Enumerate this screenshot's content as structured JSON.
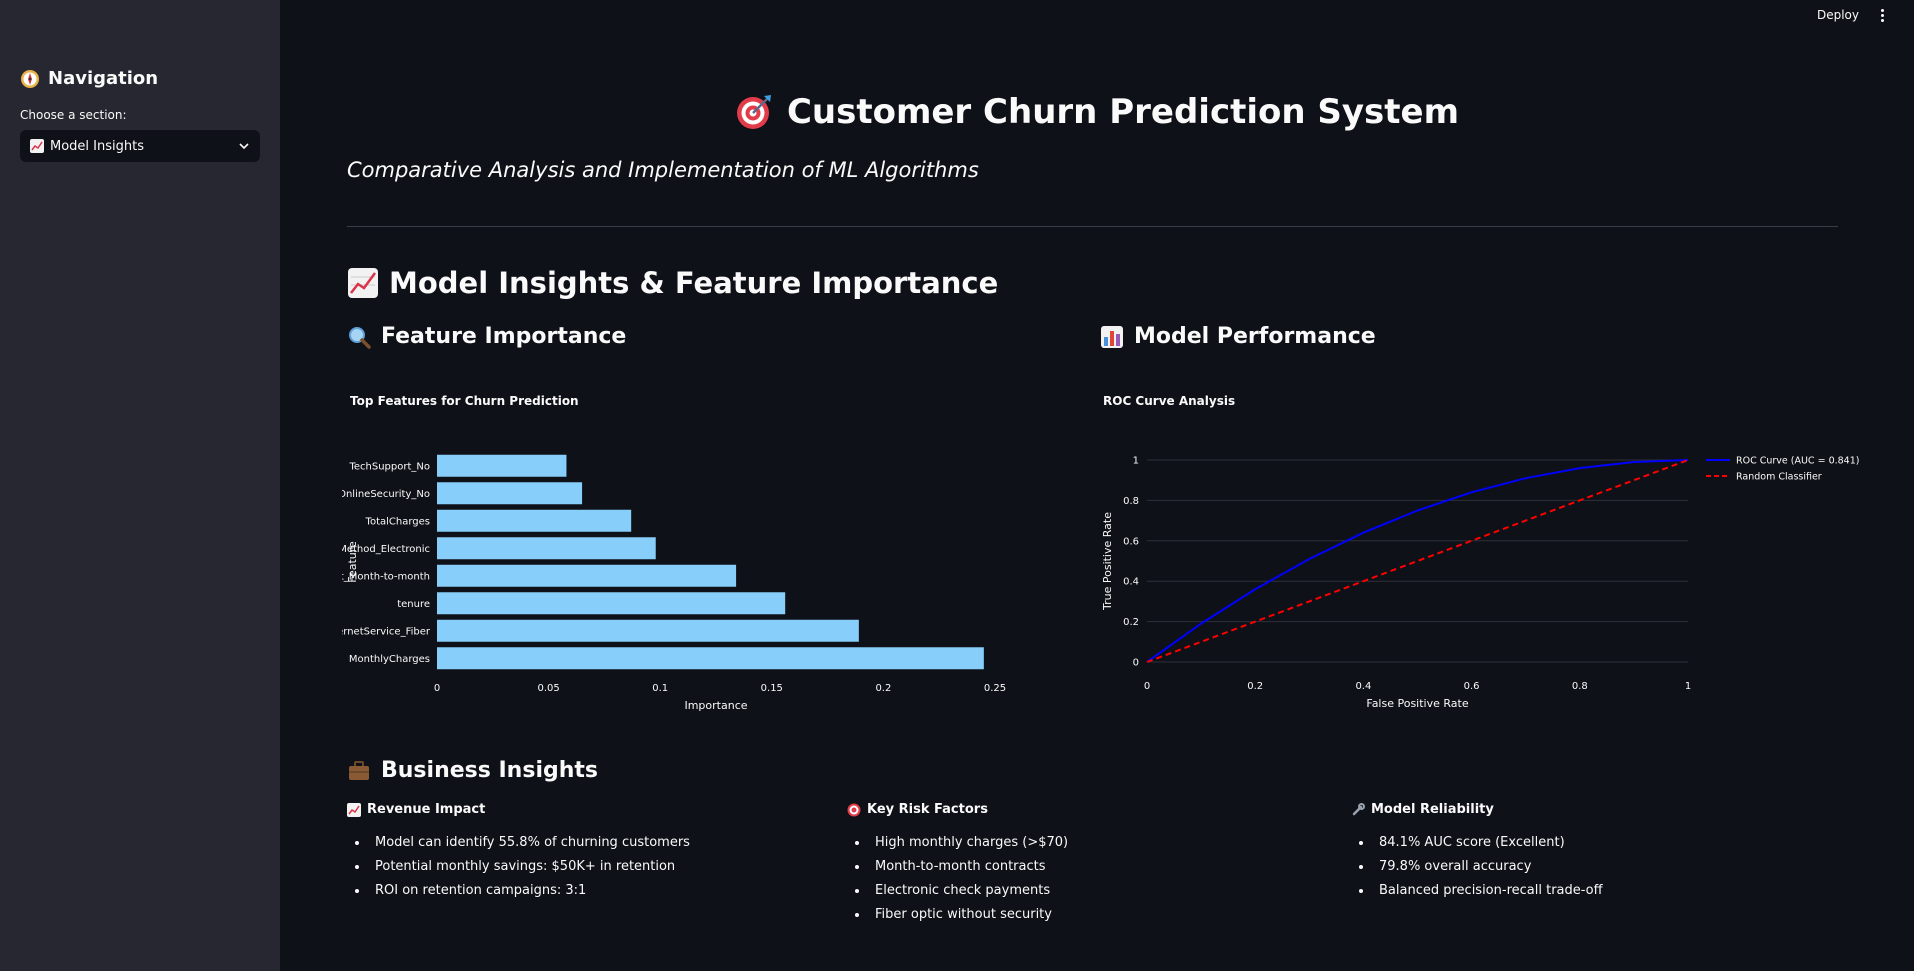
{
  "topbar": {
    "deploy_label": "Deploy",
    "menu_icon": "more-vert-icon"
  },
  "sidebar": {
    "title": "Navigation",
    "title_icon": "compass-icon",
    "select_label": "Choose a section:",
    "selected": "Model Insights",
    "selected_icon": "chart-up-icon"
  },
  "header": {
    "title": "Customer Churn Prediction System",
    "title_icon": "target-icon",
    "subtitle": "Comparative Analysis and Implementation of ML Algorithms"
  },
  "section": {
    "title": "Model Insights & Feature Importance",
    "title_icon": "chart-up-icon"
  },
  "feature_panel": {
    "title": "Feature Importance",
    "title_icon": "magnifier-icon"
  },
  "performance_panel": {
    "title": "Model Performance",
    "title_icon": "bar-chart-icon"
  },
  "chart_data": [
    {
      "type": "bar",
      "orientation": "horizontal",
      "title": "Top Features for Churn Prediction",
      "xlabel": "Importance",
      "ylabel": "Feature",
      "categories": [
        "TechSupport_No",
        "OnlineSecurity_No",
        "TotalCharges",
        "PaymentMethod_Electronic",
        "Contract_Month-to-month",
        "tenure",
        "InternetService_Fiber",
        "MonthlyCharges"
      ],
      "values": [
        0.058,
        0.065,
        0.087,
        0.098,
        0.134,
        0.156,
        0.189,
        0.245
      ],
      "xlim": [
        0,
        0.25
      ],
      "xticks": [
        "0",
        "0.05",
        "0.1",
        "0.15",
        "0.2",
        "0.25"
      ],
      "color": "#87cefa"
    },
    {
      "type": "line",
      "title": "ROC Curve Analysis",
      "xlabel": "False Positive Rate",
      "ylabel": "True Positive Rate",
      "xlim": [
        0,
        1
      ],
      "ylim": [
        0,
        1
      ],
      "xticks": [
        "0",
        "0.2",
        "0.4",
        "0.6",
        "0.8",
        "1"
      ],
      "yticks": [
        "0",
        "0.2",
        "0.4",
        "0.6",
        "0.8",
        "1"
      ],
      "legend_position": "top-right",
      "series": [
        {
          "name": "ROC Curve (AUC = 0.841)",
          "color": "#0000ff",
          "dash": "solid",
          "x": [
            0,
            0.1,
            0.2,
            0.3,
            0.4,
            0.5,
            0.6,
            0.7,
            0.8,
            0.9,
            1.0
          ],
          "y": [
            0,
            0.19,
            0.36,
            0.51,
            0.64,
            0.75,
            0.84,
            0.91,
            0.96,
            0.99,
            1.0
          ]
        },
        {
          "name": "Random Classifier",
          "color": "#ff0000",
          "dash": "dashed",
          "x": [
            0,
            1
          ],
          "y": [
            0,
            1
          ]
        }
      ]
    }
  ],
  "business": {
    "title": "Business Insights",
    "title_icon": "briefcase-icon",
    "columns": [
      {
        "heading": "Revenue Impact",
        "icon": "chart-up-icon",
        "items": [
          "Model can identify 55.8% of churning customers",
          "Potential monthly savings: $50K+ in retention",
          "ROI on retention campaigns: 3:1"
        ]
      },
      {
        "heading": "Key Risk Factors",
        "icon": "target-icon",
        "items": [
          "High monthly charges (>$70)",
          "Month-to-month contracts",
          "Electronic check payments",
          "Fiber optic without security"
        ]
      },
      {
        "heading": "Model Reliability",
        "icon": "wrench-icon",
        "items": [
          "84.1% AUC score (Excellent)",
          "79.8% overall accuracy",
          "Balanced precision-recall trade-off"
        ]
      }
    ]
  }
}
